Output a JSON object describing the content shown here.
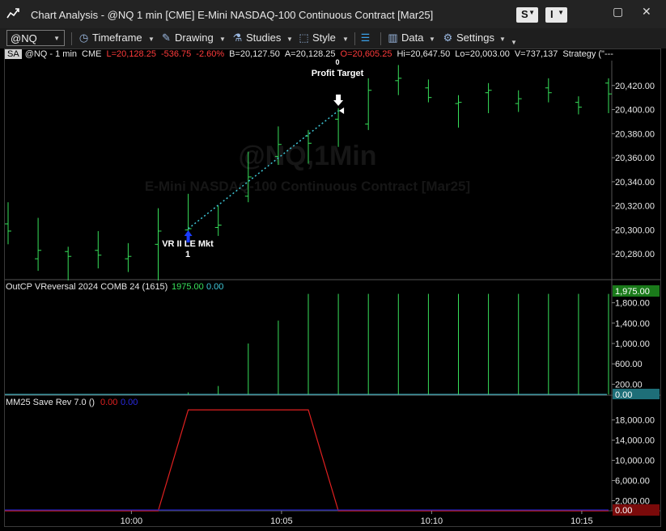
{
  "window": {
    "title": "Chart Analysis - @NQ 1 min [CME] E-Mini NASDAQ-100 Continuous Contract [Mar25]",
    "btn_s": "S",
    "btn_i": "I",
    "minimize": "▢",
    "close": "✕"
  },
  "toolbar": {
    "symbol": "@NQ",
    "timeframe": "Timeframe",
    "drawing": "Drawing",
    "studies": "Studies",
    "style": "Style",
    "data": "Data",
    "settings": "Settings"
  },
  "infobar": {
    "sa": "SA",
    "symbol": "@NQ - 1 min",
    "exchange": "CME",
    "last": "L=20,128.25",
    "change": "-536.75",
    "pct": "-2.60%",
    "bid": "B=20,127.50",
    "ask": "A=20,128.25",
    "open": "O=20,605.25",
    "high": "Hi=20,647.50",
    "low": "Lo=20,003.00",
    "volume": "V=737,137",
    "strategy": "Strategy (\"---"
  },
  "watermark": {
    "symbol": "@NQ,1Min",
    "name": "E-Mini NASDAQ-100 Continuous Contract [Mar25]"
  },
  "annotations": {
    "entry": "VR II LE Mkt",
    "entry_qty": "1",
    "exit": "Profit Target",
    "exit_qty": "0"
  },
  "colors": {
    "bar": "#37e05a",
    "trade_line": "#3fc8d8",
    "entry_arrow": "#1a3cff",
    "exit_arrow": "#ffffff",
    "mm_line": "#e02020",
    "mm_line2": "#2020c0",
    "lastval_green": "#1a7a1a",
    "lastval_teal": "#1e6e78",
    "lastval_red": "#7a0a0a"
  },
  "chart_data": [
    {
      "type": "ohlc",
      "title": "",
      "ylim": [
        20260,
        20440
      ],
      "y_ticks": [
        "20,420.00",
        "20,400.00",
        "20,380.00",
        "20,360.00",
        "20,340.00",
        "20,320.00",
        "20,300.00",
        "20,280.00"
      ],
      "y_tick_values": [
        20420,
        20400,
        20380,
        20360,
        20340,
        20320,
        20300,
        20280
      ],
      "bars": [
        {
          "h": 20323,
          "l": 20288,
          "o": 20305,
          "c": 20299
        },
        {
          "h": 20310,
          "l": 20266,
          "o": 20276,
          "c": 20283
        },
        {
          "h": 20286,
          "l": 20258,
          "o": 20282,
          "c": 20278
        },
        {
          "h": 20299,
          "l": 20268,
          "o": 20283,
          "c": 20279
        },
        {
          "h": 20289,
          "l": 20265,
          "o": 20276,
          "c": 20278
        },
        {
          "h": 20318,
          "l": 20258,
          "o": 20288,
          "c": 20299
        },
        {
          "h": 20330,
          "l": 20293,
          "o": 20300,
          "c": 20301
        },
        {
          "h": 20320,
          "l": 20295,
          "o": 20302,
          "c": 20304
        },
        {
          "h": 20365,
          "l": 20323,
          "o": 20328,
          "c": 20344
        },
        {
          "h": 20386,
          "l": 20354,
          "o": 20361,
          "c": 20371
        },
        {
          "h": 20383,
          "l": 20355,
          "o": 20378,
          "c": 20372
        },
        {
          "h": 20401,
          "l": 20369,
          "o": 20392,
          "c": 20399
        },
        {
          "h": 20426,
          "l": 20383,
          "o": 20388,
          "c": 20416
        },
        {
          "h": 20437,
          "l": 20412,
          "o": 20424,
          "c": 20426
        },
        {
          "h": 20425,
          "l": 20406,
          "o": 20418,
          "c": 20410
        },
        {
          "h": 20412,
          "l": 20385,
          "o": 20405,
          "c": 20406
        },
        {
          "h": 20422,
          "l": 20397,
          "o": 20414,
          "c": 20416
        },
        {
          "h": 20416,
          "l": 20398,
          "o": 20405,
          "c": 20409
        },
        {
          "h": 20426,
          "l": 20406,
          "o": 20418,
          "c": 20414
        },
        {
          "h": 20411,
          "l": 20396,
          "o": 20406,
          "c": 20402
        },
        {
          "h": 20426,
          "l": 20397,
          "o": 20422,
          "c": 20413
        }
      ]
    },
    {
      "type": "bar",
      "title": "OutCP VReversal 2024 COMB 24 (1615)",
      "value1": "1975.00",
      "value2": "0.00",
      "last_label": "1,975.00",
      "zero_label": "0.00",
      "ylim": [
        0,
        2000
      ],
      "y_ticks": [
        "1,800.00",
        "1,400.00",
        "1,000.00",
        "600.00",
        "200.00"
      ],
      "y_tick_values": [
        1800,
        1400,
        1000,
        600,
        200
      ],
      "values": [
        0,
        0,
        0,
        0,
        0,
        0,
        40,
        165,
        1000,
        1450,
        1975,
        1975,
        1975,
        1975,
        1975,
        1975,
        1975,
        1975,
        1975,
        1975,
        1975
      ]
    },
    {
      "type": "line",
      "title": "MM25 Save Rev 7.0 ()",
      "value1": "0.00",
      "value2": "0.00",
      "last_label": "0.00",
      "ylim": [
        0,
        20500
      ],
      "y_ticks": [
        "18,000.00",
        "14,000.00",
        "10,000.00",
        "6,000.00",
        "2,000.00"
      ],
      "y_tick_values": [
        18000,
        14000,
        10000,
        6000,
        2000
      ],
      "series": [
        {
          "values": [
            0,
            0,
            0,
            0,
            0,
            0,
            20000,
            20000,
            20000,
            20000,
            20000,
            0,
            0,
            0,
            0,
            0,
            0,
            0,
            0,
            0,
            0
          ]
        },
        {
          "values": [
            0,
            0,
            0,
            0,
            0,
            0,
            0,
            0,
            0,
            0,
            0,
            0,
            0,
            0,
            0,
            0,
            0,
            0,
            0,
            0,
            0
          ]
        }
      ]
    }
  ],
  "x_axis": {
    "labels": [
      "10:00",
      "10:05",
      "10:10",
      "10:15"
    ]
  }
}
